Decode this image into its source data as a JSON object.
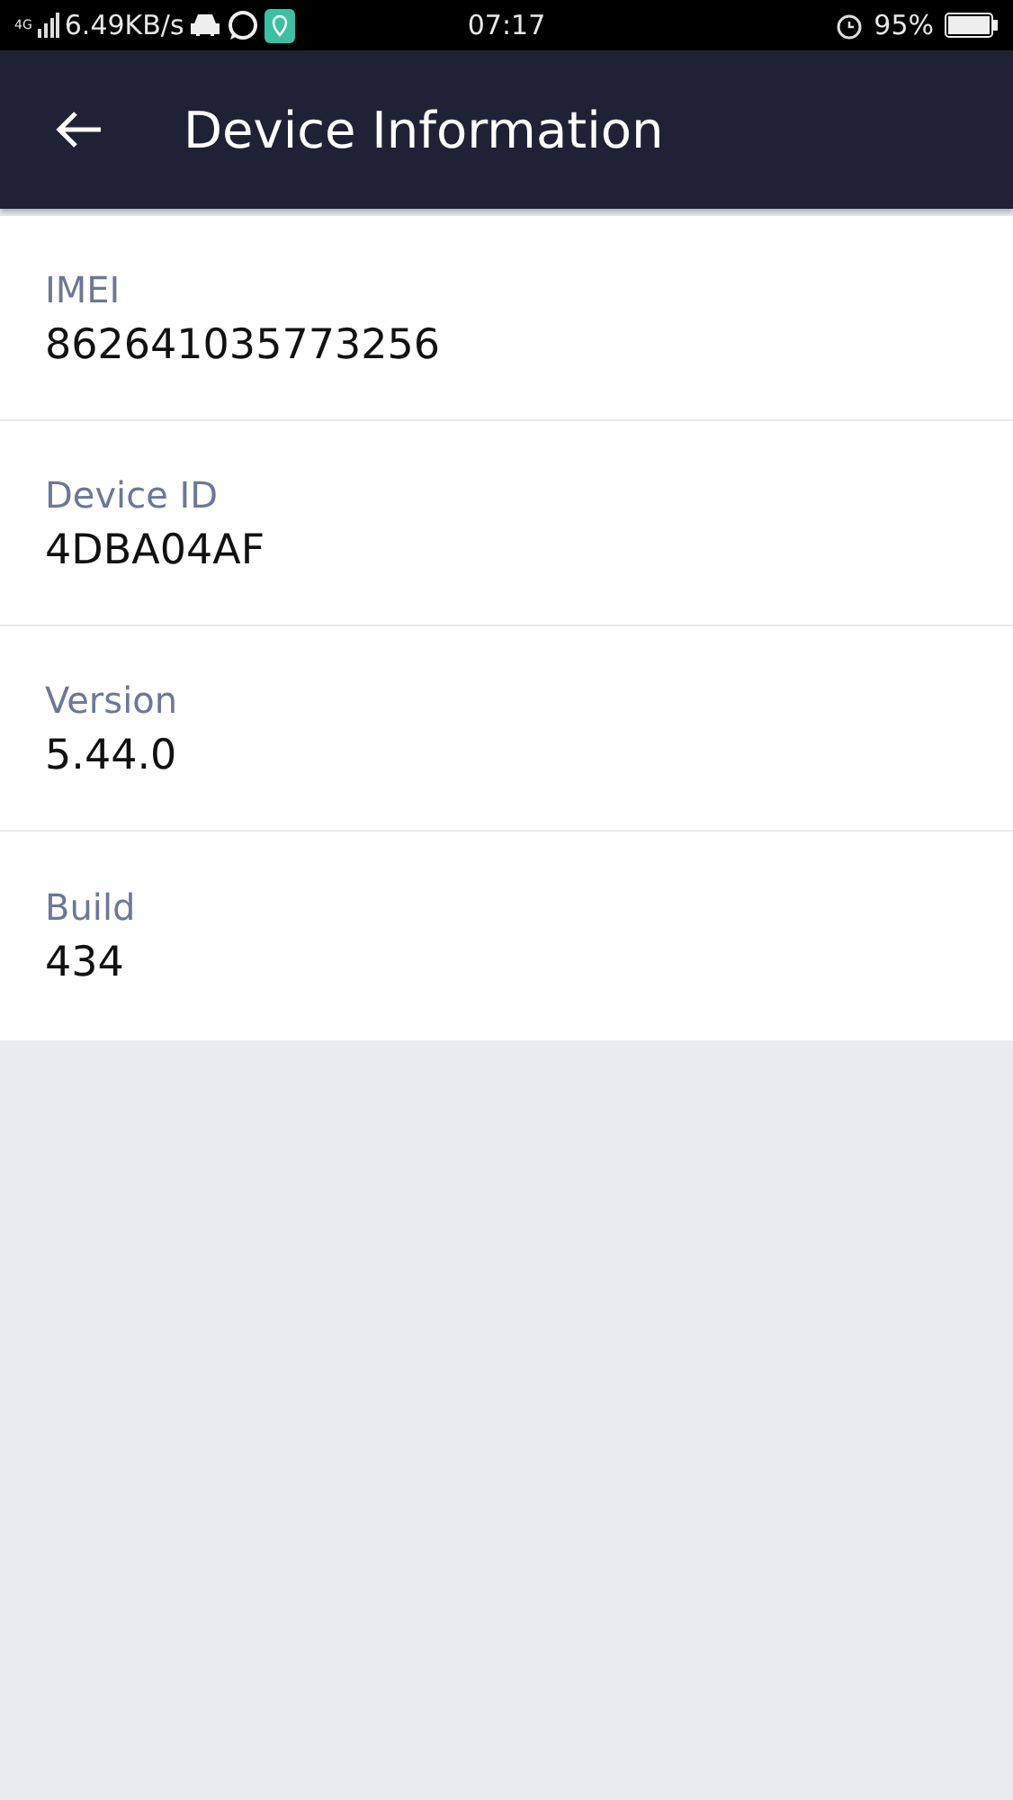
{
  "status_bar": {
    "network": "4G",
    "speed": "6.49KB/s",
    "time": "07:17",
    "battery": "95%"
  },
  "app_bar": {
    "title": "Device Information"
  },
  "fields": [
    {
      "label": "IMEI",
      "value": "862641035773256"
    },
    {
      "label": "Device ID",
      "value": "4DBA04AF"
    },
    {
      "label": "Version",
      "value": "5.44.0"
    },
    {
      "label": "Build",
      "value": "434"
    }
  ]
}
